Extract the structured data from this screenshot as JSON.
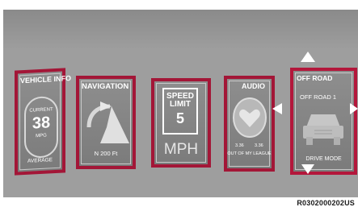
{
  "cards": {
    "vehicle_info": {
      "title": "VEHICLE INFO",
      "current_label": "CURRENT",
      "value": "38",
      "unit": "MPG",
      "mode": "AVERAGE"
    },
    "navigation": {
      "title": "NAVIGATION",
      "distance": "N 200 Ft"
    },
    "speed_limit": {
      "line1": "SPEED",
      "line2": "LIMIT",
      "value": "5",
      "unit": "MPH"
    },
    "audio": {
      "title": "AUDIO",
      "time_left": "3.36",
      "time_right": "3.36",
      "track": "OUT OF MY LEAGUE"
    },
    "off_road": {
      "title": "OFF ROAD",
      "subtitle": "OFF ROAD 1",
      "mode": "DRIVE MODE"
    }
  },
  "caption": "R0302000202US",
  "colors": {
    "card_border": "#a31637",
    "background": "#9e9e9e"
  }
}
